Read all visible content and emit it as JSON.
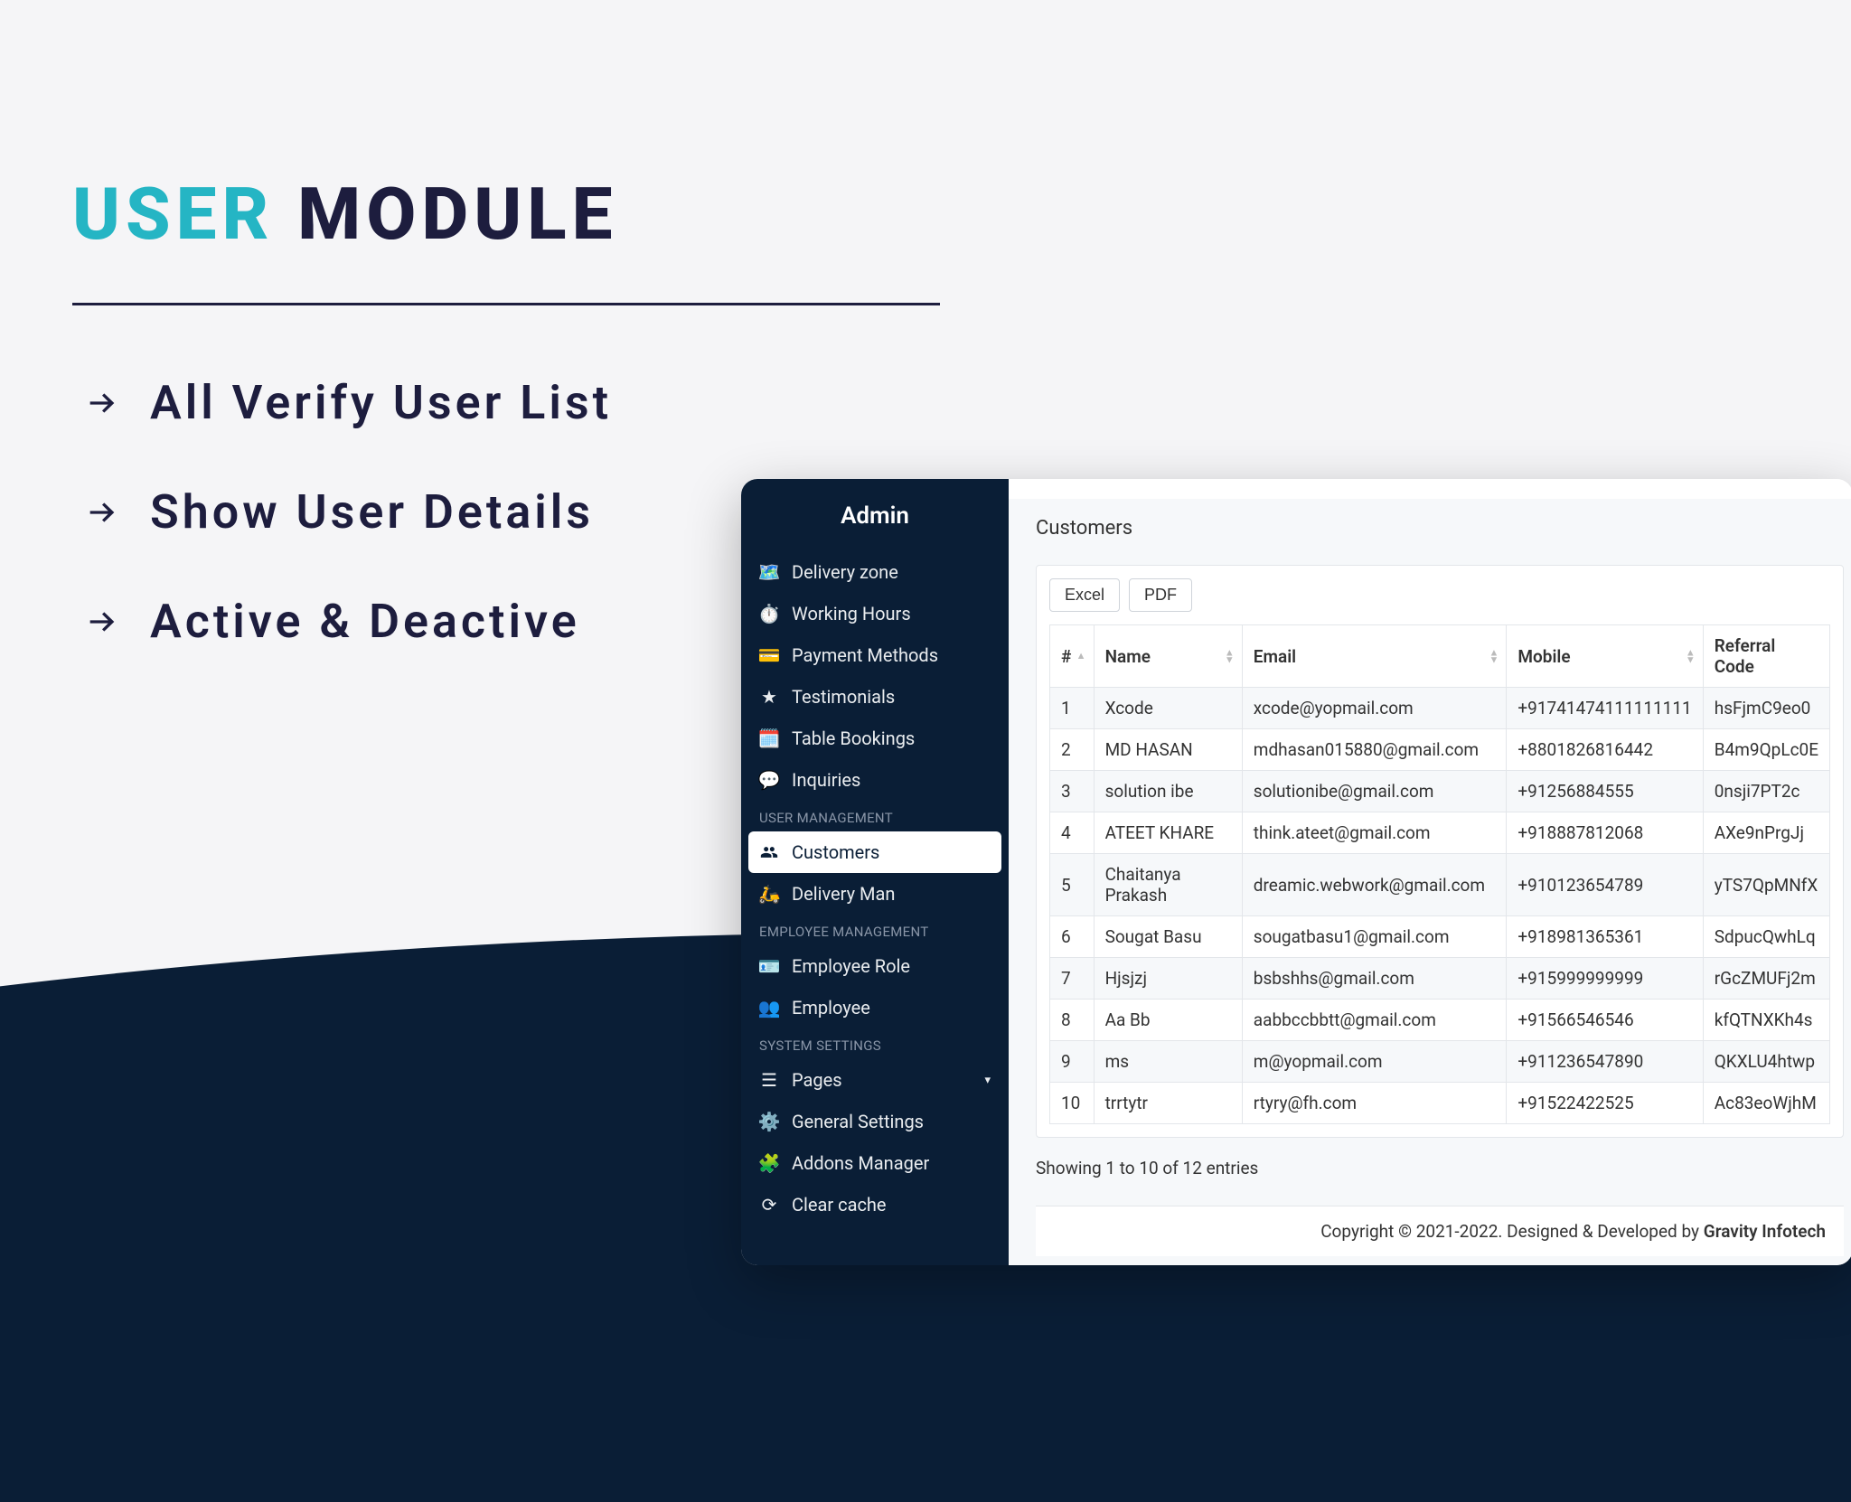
{
  "heading": {
    "part1": "USER",
    "part2": "MODULE"
  },
  "features": [
    "All Verify User List",
    "Show User Details",
    "Active & Deactive"
  ],
  "sidebar": {
    "title": "Admin",
    "items": [
      {
        "label": "Delivery zone"
      },
      {
        "label": "Working Hours"
      },
      {
        "label": "Payment Methods"
      },
      {
        "label": "Testimonials"
      },
      {
        "label": "Table Bookings"
      },
      {
        "label": "Inquiries"
      }
    ],
    "sections": {
      "user_mgmt": "USER MANAGEMENT",
      "employee_mgmt": "EMPLOYEE MANAGEMENT",
      "system_settings": "SYSTEM SETTINGS"
    },
    "user_items": [
      {
        "label": "Customers",
        "active": true
      },
      {
        "label": "Delivery Man"
      }
    ],
    "employee_items": [
      {
        "label": "Employee Role"
      },
      {
        "label": "Employee"
      }
    ],
    "system_items": [
      {
        "label": "Pages",
        "has_chevron": true
      },
      {
        "label": "General Settings"
      },
      {
        "label": "Addons Manager"
      },
      {
        "label": "Clear cache"
      }
    ]
  },
  "page": {
    "title": "Customers",
    "export": {
      "excel": "Excel",
      "pdf": "PDF"
    },
    "columns": {
      "idx": "#",
      "name": "Name",
      "email": "Email",
      "mobile": "Mobile",
      "referral": "Referral Code"
    },
    "rows": [
      {
        "idx": "1",
        "name": "Xcode",
        "email": "xcode@yopmail.com",
        "mobile": "+91741474111111111",
        "referral": "hsFjmC9eo0"
      },
      {
        "idx": "2",
        "name": "MD HASAN",
        "email": "mdhasan015880@gmail.com",
        "mobile": "+8801826816442",
        "referral": "B4m9QpLc0E"
      },
      {
        "idx": "3",
        "name": "solution ibe",
        "email": "solutionibe@gmail.com",
        "mobile": "+91256884555",
        "referral": "0nsji7PT2c"
      },
      {
        "idx": "4",
        "name": "ATEET KHARE",
        "email": "think.ateet@gmail.com",
        "mobile": "+918887812068",
        "referral": "AXe9nPrgJj"
      },
      {
        "idx": "5",
        "name": "Chaitanya Prakash",
        "email": "dreamic.webwork@gmail.com",
        "mobile": "+910123654789",
        "referral": "yTS7QpMNfX"
      },
      {
        "idx": "6",
        "name": "Sougat Basu",
        "email": "sougatbasu1@gmail.com",
        "mobile": "+918981365361",
        "referral": "SdpucQwhLq"
      },
      {
        "idx": "7",
        "name": "Hjsjzj",
        "email": "bsbshhs@gmail.com",
        "mobile": "+915999999999",
        "referral": "rGcZMUFj2m"
      },
      {
        "idx": "8",
        "name": "Aa Bb",
        "email": "aabbccbbtt@gmail.com",
        "mobile": "+91566546546",
        "referral": "kfQTNXKh4s"
      },
      {
        "idx": "9",
        "name": "ms",
        "email": "m@yopmail.com",
        "mobile": "+911236547890",
        "referral": "QKXLU4htwp"
      },
      {
        "idx": "10",
        "name": "trrtytr",
        "email": "rtyry@fh.com",
        "mobile": "+91522422525",
        "referral": "Ac83eoWjhM"
      }
    ],
    "entries_info": "Showing 1 to 10 of 12 entries"
  },
  "footer": {
    "text": "Copyright © 2021-2022. Designed & Developed by ",
    "brand": "Gravity Infotech"
  }
}
